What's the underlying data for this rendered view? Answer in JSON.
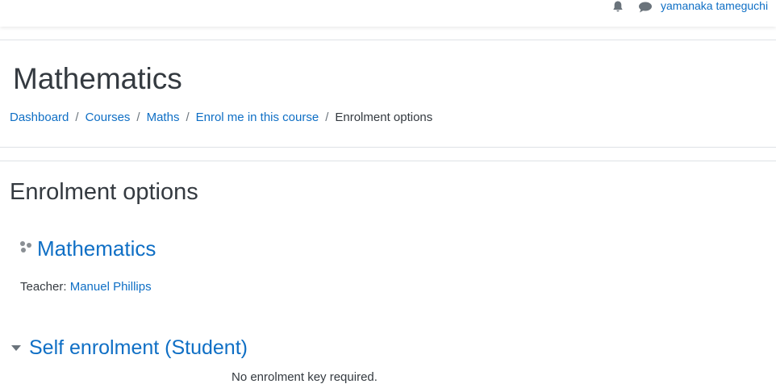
{
  "header": {
    "user_name": "yamanaka tameguchi",
    "icons": {
      "notifications": "bell-icon",
      "messages": "chat-bubble-icon"
    }
  },
  "page": {
    "title": "Mathematics"
  },
  "breadcrumb": {
    "items": [
      "Dashboard",
      "Courses",
      "Maths",
      "Enrol me in this course"
    ],
    "current": "Enrolment options",
    "separator": "/"
  },
  "main": {
    "heading": "Enrolment options",
    "course": {
      "name": "Mathematics",
      "icon": "course-icon",
      "teacher_label": "Teacher:",
      "teacher_name": "Manuel Phillips"
    },
    "enrolment": {
      "heading": "Self enrolment (Student)",
      "message": "No enrolment key required."
    }
  },
  "colors": {
    "link": "#0f6fc5",
    "text": "#343a40",
    "rule": "#dee2e6"
  }
}
